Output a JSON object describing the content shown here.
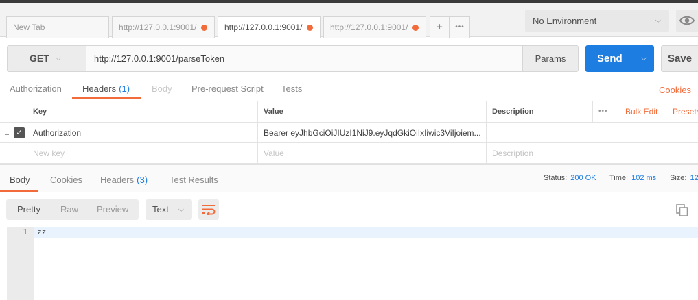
{
  "tabs": [
    {
      "title": "New Tab",
      "unsaved": false,
      "active": false
    },
    {
      "title": "http://127.0.0.1:9001/",
      "unsaved": true,
      "active": false
    },
    {
      "title": "http://127.0.0.1:9001/",
      "unsaved": true,
      "active": true
    },
    {
      "title": "http://127.0.0.1:9001/",
      "unsaved": true,
      "active": false
    }
  ],
  "tab_actions": {
    "add": "+",
    "more": "•••"
  },
  "environment": {
    "selected": "No Environment"
  },
  "request": {
    "method": "GET",
    "url": "http://127.0.0.1:9001/parseToken",
    "params_label": "Params",
    "send_label": "Send",
    "save_label": "Save"
  },
  "request_tabs": [
    {
      "label": "Authorization",
      "count": "",
      "state": "normal"
    },
    {
      "label": "Headers",
      "count": "(1)",
      "state": "active"
    },
    {
      "label": "Body",
      "count": "",
      "state": "disabled"
    },
    {
      "label": "Pre-request Script",
      "count": "",
      "state": "normal"
    },
    {
      "label": "Tests",
      "count": "",
      "state": "normal"
    }
  ],
  "cookies_link": "Cookies",
  "headers_table": {
    "columns": {
      "key": "Key",
      "value": "Value",
      "description": "Description"
    },
    "more": "•••",
    "bulk_edit": "Bulk Edit",
    "presets": "Presets",
    "rows": [
      {
        "checked": true,
        "key": "Authorization",
        "value": "Bearer eyJhbGciOiJIUzI1NiJ9.eyJqdGkiOiIxIiwic3ViIjoiem...",
        "description": ""
      }
    ],
    "placeholders": {
      "key": "New key",
      "value": "Value",
      "description": "Description"
    }
  },
  "response_tabs": [
    {
      "label": "Body",
      "count": "",
      "active": true
    },
    {
      "label": "Cookies",
      "count": "",
      "active": false
    },
    {
      "label": "Headers",
      "count": "(3)",
      "active": false
    },
    {
      "label": "Test Results",
      "count": "",
      "active": false
    }
  ],
  "response_status": {
    "status_label": "Status:",
    "status": "200 OK",
    "time_label": "Time:",
    "time": "102 ms",
    "size_label": "Size:",
    "size": "12"
  },
  "body_view": {
    "modes": [
      "Pretty",
      "Raw",
      "Preview"
    ],
    "active_mode": "Pretty",
    "format": "Text"
  },
  "response_body": {
    "lines": [
      {
        "number": "1",
        "text": "zz"
      }
    ]
  },
  "colors": {
    "accent": "#f26b3a",
    "send": "#1e7de0",
    "link_blue": "#1e7de0"
  }
}
